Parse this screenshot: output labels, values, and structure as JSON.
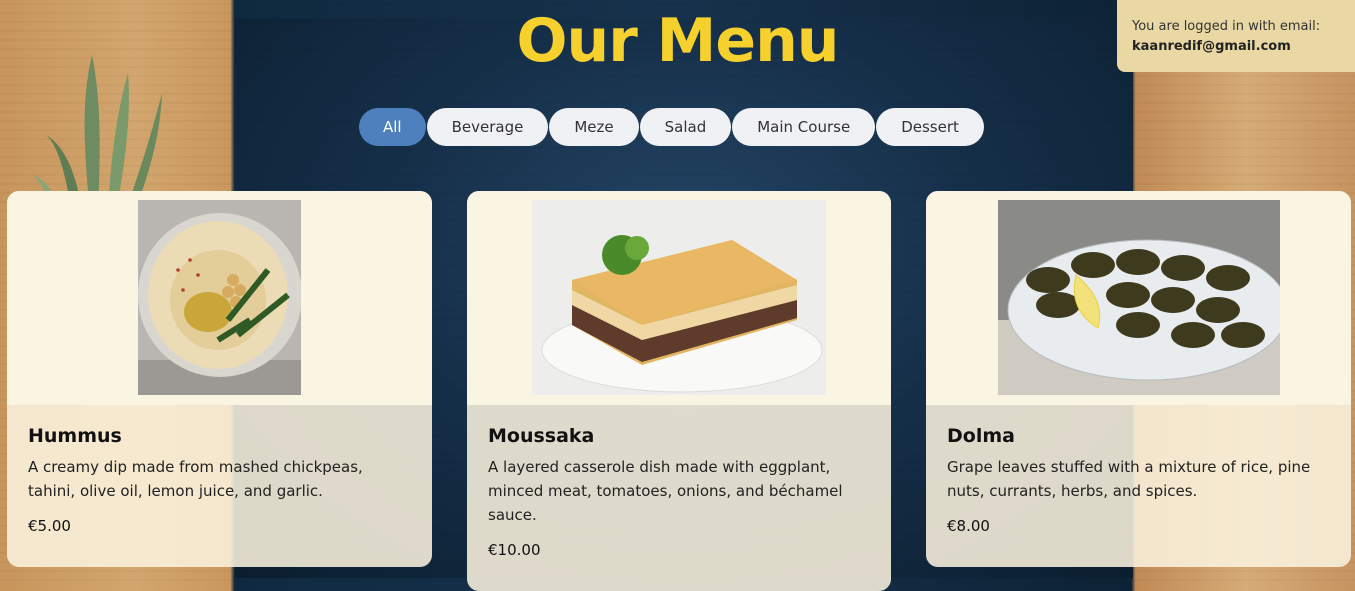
{
  "page": {
    "title": "Our Menu"
  },
  "login": {
    "prefix": "You are logged in with email:",
    "email": "kaanredif@gmail.com"
  },
  "filters": [
    {
      "label": "All",
      "active": true
    },
    {
      "label": "Beverage",
      "active": false
    },
    {
      "label": "Meze",
      "active": false
    },
    {
      "label": "Salad",
      "active": false
    },
    {
      "label": "Main Course",
      "active": false
    },
    {
      "label": "Dessert",
      "active": false
    }
  ],
  "items": [
    {
      "name": "Hummus",
      "description": "A creamy dip made from mashed chickpeas, tahini, olive oil, lemon juice, and garlic.",
      "price": "€5.00",
      "image_icon": "hummus-photo"
    },
    {
      "name": "Moussaka",
      "description": "A layered casserole dish made with eggplant, minced meat, tomatoes, onions, and béchamel sauce.",
      "price": "€10.00",
      "image_icon": "moussaka-photo"
    },
    {
      "name": "Dolma",
      "description": "Grape leaves stuffed with a mixture of rice, pine nuts, currants, herbs, and spices.",
      "price": "€8.00",
      "image_icon": "dolma-photo"
    }
  ],
  "colors": {
    "title": "#f6d02c",
    "active_filter": "#4d80bd",
    "filter_bg": "#f0f1f4",
    "card_bg": "#faf3de",
    "login_bg": "#e9d8a4"
  }
}
